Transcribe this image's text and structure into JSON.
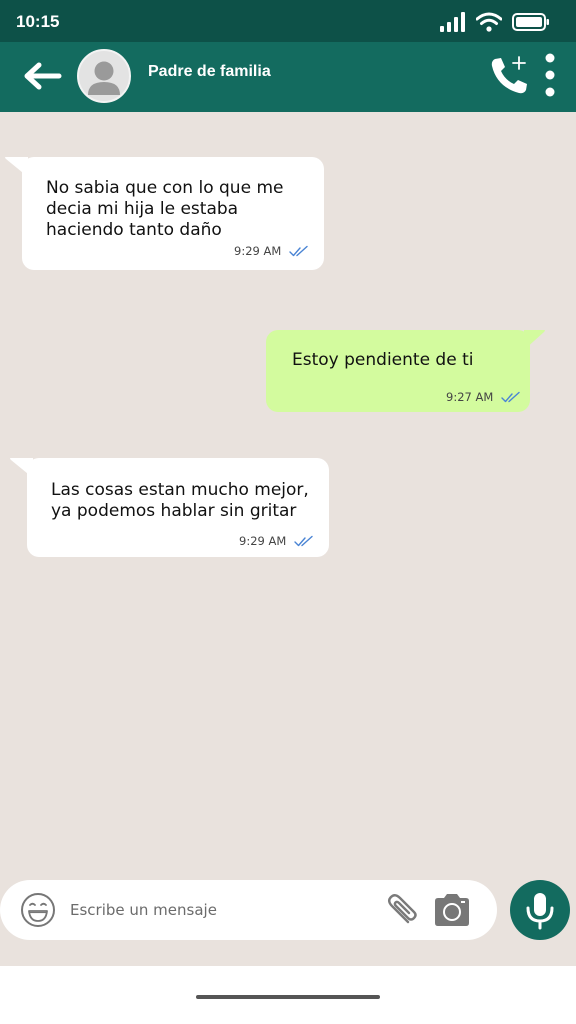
{
  "status_bar": {
    "time": "10:15",
    "icons": [
      "signal-icon",
      "wifi-icon",
      "battery-icon"
    ]
  },
  "header": {
    "contact_name": "Padre de familia",
    "icons": [
      "back-arrow-icon",
      "avatar-icon",
      "add-call-icon",
      "more-vert-icon"
    ]
  },
  "messages": [
    {
      "direction": "incoming",
      "text": "No sabia que con lo que me\ndecia mi hija le estaba\nhaciendo tanto daño",
      "time": "9:29 AM",
      "status": "read"
    },
    {
      "direction": "outgoing",
      "text": "Estoy pendiente de ti",
      "time": "9:27 AM",
      "status": "read"
    },
    {
      "direction": "incoming",
      "text": "Las cosas estan mucho mejor,\nya podemos hablar sin gritar",
      "time": "9:29 AM",
      "status": "read"
    }
  ],
  "composer": {
    "placeholder": "Escribe un mensaje",
    "icons": [
      "emoji-icon",
      "paperclip-icon",
      "camera-icon",
      "microphone-icon"
    ]
  },
  "colors": {
    "status_bar": "#0d5148",
    "header": "#136b5f",
    "chat_background": "#e9e2dd",
    "incoming_bubble": "#ffffff",
    "outgoing_bubble": "#d3fb9e",
    "read_ticks": "#4a84d4"
  }
}
